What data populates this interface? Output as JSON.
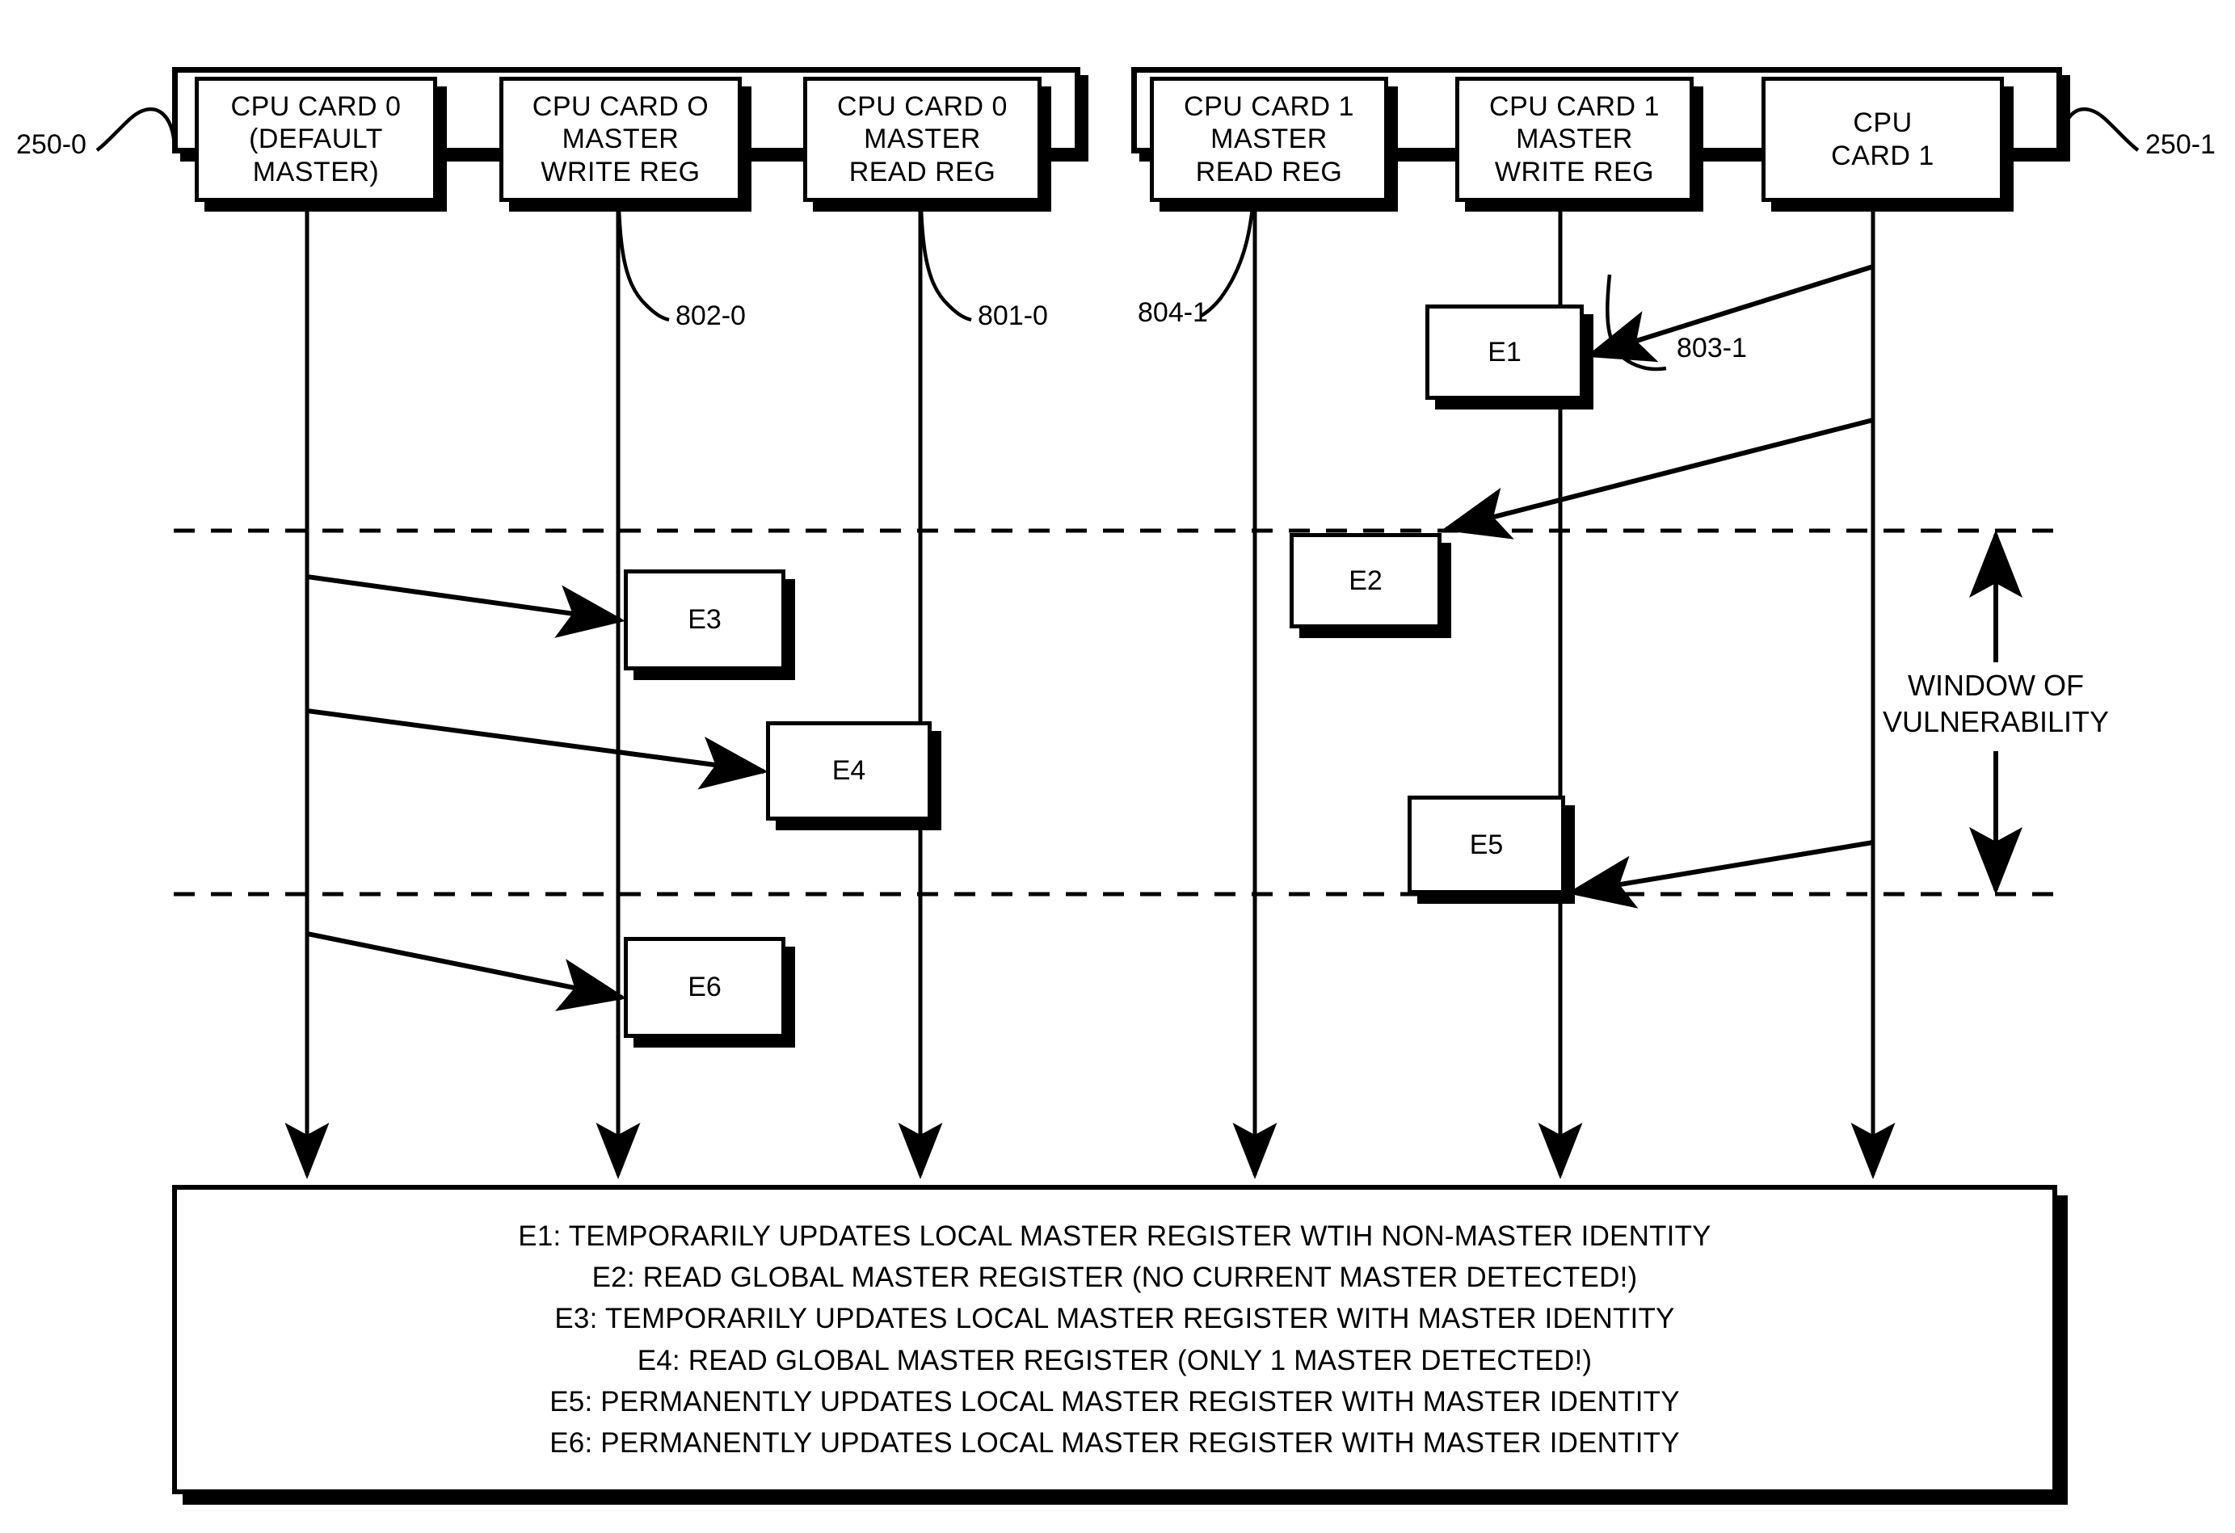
{
  "diagram": {
    "title": "CPU card master-arbitration timing diagram",
    "groups": [
      {
        "id": "group-left",
        "ref": "250-0"
      },
      {
        "id": "group-right",
        "ref": "250-1"
      }
    ],
    "cards": [
      {
        "id": "card-cpu0-default-master",
        "lines": [
          "CPU CARD 0",
          "(DEFAULT",
          "MASTER)"
        ]
      },
      {
        "id": "card-cpu0-master-write-reg",
        "lines": [
          "CPU CARD O",
          "MASTER",
          "WRITE REG"
        ]
      },
      {
        "id": "card-cpu0-master-read-reg",
        "lines": [
          "CPU CARD 0",
          "MASTER",
          "READ REG"
        ]
      },
      {
        "id": "card-cpu1-master-read-reg",
        "lines": [
          "CPU CARD 1",
          "MASTER",
          "READ REG"
        ]
      },
      {
        "id": "card-cpu1-master-write-reg",
        "lines": [
          "CPU CARD 1",
          "MASTER",
          "WRITE REG"
        ]
      },
      {
        "id": "card-cpu1",
        "lines": [
          "CPU",
          "CARD 1"
        ]
      }
    ],
    "ref_labels": [
      {
        "id": "ref-250-0",
        "text": "250-0"
      },
      {
        "id": "ref-250-1",
        "text": "250-1"
      },
      {
        "id": "ref-802-0",
        "text": "802-0"
      },
      {
        "id": "ref-801-0",
        "text": "801-0"
      },
      {
        "id": "ref-804-1",
        "text": "804-1"
      },
      {
        "id": "ref-803-1",
        "text": "803-1"
      }
    ],
    "event_boxes": [
      {
        "id": "event-e1",
        "label": "E1"
      },
      {
        "id": "event-e2",
        "label": "E2"
      },
      {
        "id": "event-e3",
        "label": "E3"
      },
      {
        "id": "event-e4",
        "label": "E4"
      },
      {
        "id": "event-e5",
        "label": "E5"
      },
      {
        "id": "event-e6",
        "label": "E6"
      }
    ],
    "annotation": {
      "window_of_vulnerability_line1": "WINDOW OF",
      "window_of_vulnerability_line2": "VULNERABILITY"
    },
    "legend": {
      "lines": [
        "E1: TEMPORARILY UPDATES LOCAL MASTER REGISTER WTIH NON-MASTER IDENTITY",
        "E2: READ GLOBAL MASTER REGISTER (NO CURRENT MASTER DETECTED!)",
        "E3: TEMPORARILY UPDATES LOCAL MASTER REGISTER WITH MASTER IDENTITY",
        "E4: READ GLOBAL MASTER REGISTER (ONLY 1 MASTER DETECTED!)",
        "E5: PERMANENTLY UPDATES LOCAL MASTER REGISTER WITH MASTER IDENTITY",
        "E6: PERMANENTLY UPDATES LOCAL MASTER REGISTER WITH MASTER IDENTITY"
      ]
    },
    "colors": {
      "ink": "#000000",
      "paper": "#ffffff"
    }
  }
}
